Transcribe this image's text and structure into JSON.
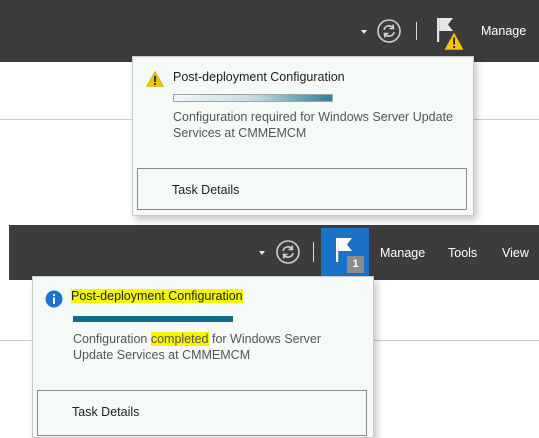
{
  "top": {
    "manage_label": "Manage",
    "notification": {
      "title": "Post-deployment Configuration",
      "message": "Configuration required for Windows Server Update Services at CMMEMCM",
      "task_details": "Task Details",
      "status_icon": "warning-triangle-icon",
      "progress": 0.85
    }
  },
  "bottom": {
    "menu": [
      "Manage",
      "Tools",
      "View"
    ],
    "notification_count": "1",
    "notification": {
      "title": "Post-deployment Configuration",
      "message_parts": [
        "Configuration ",
        "completed",
        " for Windows Server Update Services at CMMEMCM"
      ],
      "task_details": "Task Details",
      "status_icon": "info-circle-icon",
      "progress": 1.0
    }
  },
  "colors": {
    "toolbar": "#3c3c3c",
    "flag_active": "#1a73c7",
    "warning": "#f5c400",
    "info": "#1a73d0",
    "progress_fill": "#0f6c8a",
    "highlight": "#f6f600"
  }
}
